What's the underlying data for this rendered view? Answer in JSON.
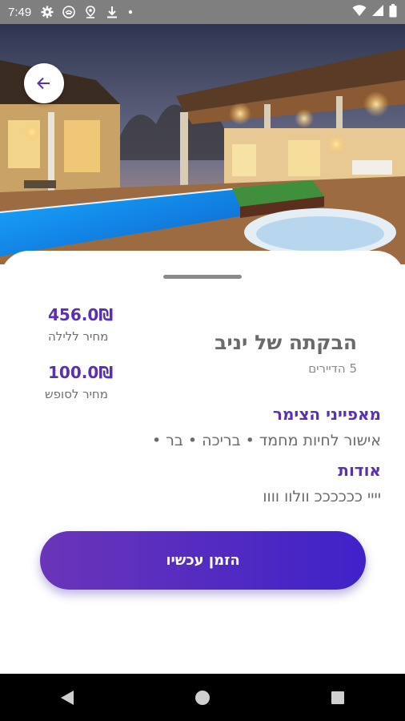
{
  "status_bar": {
    "time": "7:49",
    "icons_left": [
      "gear-icon",
      "app-notification-icon",
      "location-icon",
      "download-icon",
      "dot-icon"
    ],
    "icons_right": [
      "wifi-icon",
      "signal-icon",
      "battery-icon"
    ]
  },
  "hero": {
    "image": "villa-pool-night-photo"
  },
  "back_button": {
    "icon": "arrow-left-icon"
  },
  "listing": {
    "title": "הבקתה של יניב",
    "residents": "5 הדיירים",
    "price_night": "456.0₪",
    "price_night_label": "מחיר ללילה",
    "price_weekend": "100.0₪",
    "price_weekend_label": "מחיר לסופש"
  },
  "features": {
    "title": "מאפייני הצימר",
    "text": "אישור לחיות מחמד • בריכה • בר •"
  },
  "about": {
    "title": "אודות",
    "text": "יייי ככככככ וולוו וווו"
  },
  "order_button": {
    "label": "הזמן עכשיו"
  },
  "colors": {
    "accent": "#5b2fb1",
    "button_gradient_start": "#6a35b8",
    "button_gradient_end": "#3f22c8"
  }
}
